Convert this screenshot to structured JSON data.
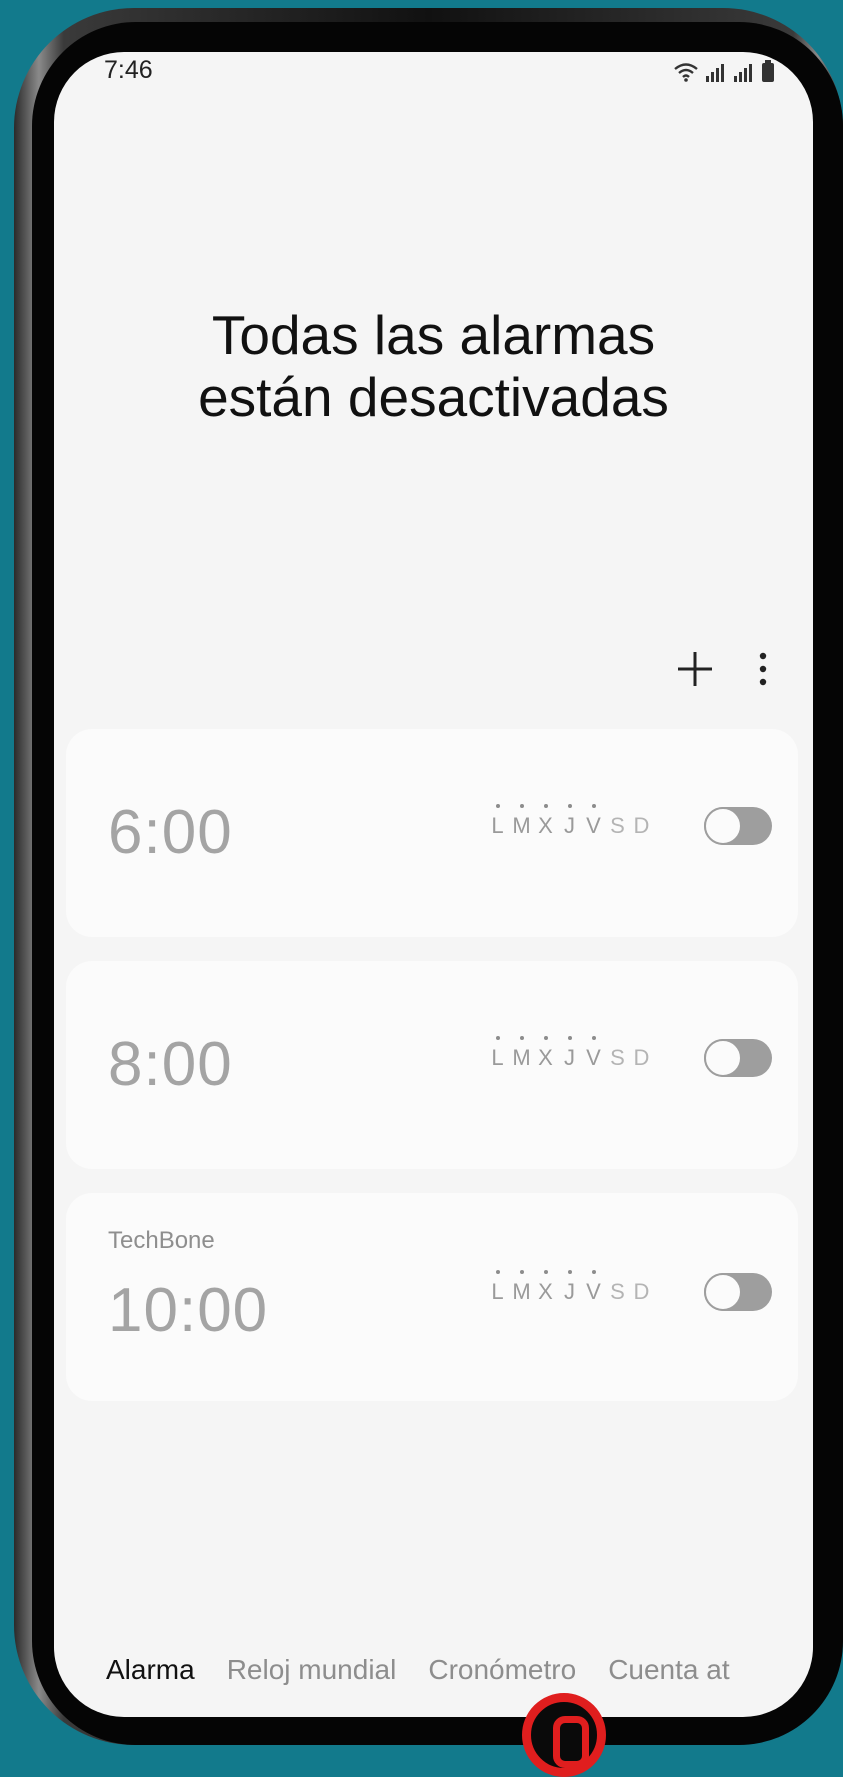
{
  "status_bar": {
    "time": "7:46"
  },
  "headline": "Todas las alarmas\nestán desactivadas",
  "toolbar": {
    "add_icon": "plus-icon",
    "more_icon": "more-vertical-icon"
  },
  "alarms": [
    {
      "label": "",
      "time": "6:00",
      "enabled": false,
      "days": [
        {
          "d": "L",
          "on": true
        },
        {
          "d": "M",
          "on": true
        },
        {
          "d": "X",
          "on": true
        },
        {
          "d": "J",
          "on": true
        },
        {
          "d": "V",
          "on": true
        },
        {
          "d": "S",
          "on": false
        },
        {
          "d": "D",
          "on": false
        }
      ]
    },
    {
      "label": "",
      "time": "8:00",
      "enabled": false,
      "days": [
        {
          "d": "L",
          "on": true
        },
        {
          "d": "M",
          "on": true
        },
        {
          "d": "X",
          "on": true
        },
        {
          "d": "J",
          "on": true
        },
        {
          "d": "V",
          "on": true
        },
        {
          "d": "S",
          "on": false
        },
        {
          "d": "D",
          "on": false
        }
      ]
    },
    {
      "label": "TechBone",
      "time": "10:00",
      "enabled": false,
      "days": [
        {
          "d": "L",
          "on": true
        },
        {
          "d": "M",
          "on": true
        },
        {
          "d": "X",
          "on": true
        },
        {
          "d": "J",
          "on": true
        },
        {
          "d": "V",
          "on": true
        },
        {
          "d": "S",
          "on": false
        },
        {
          "d": "D",
          "on": false
        }
      ]
    }
  ],
  "tabs": [
    {
      "label": "Alarma",
      "active": true
    },
    {
      "label": "Reloj mundial",
      "active": false
    },
    {
      "label": "Cronómetro",
      "active": false
    },
    {
      "label": "Cuenta at",
      "active": false
    }
  ],
  "colors": {
    "background": "#127a8c",
    "screen": "#f5f5f5",
    "card": "#fbfbfb",
    "toggle_off": "#9e9e9e",
    "camera_ring": "#e01e1e"
  }
}
